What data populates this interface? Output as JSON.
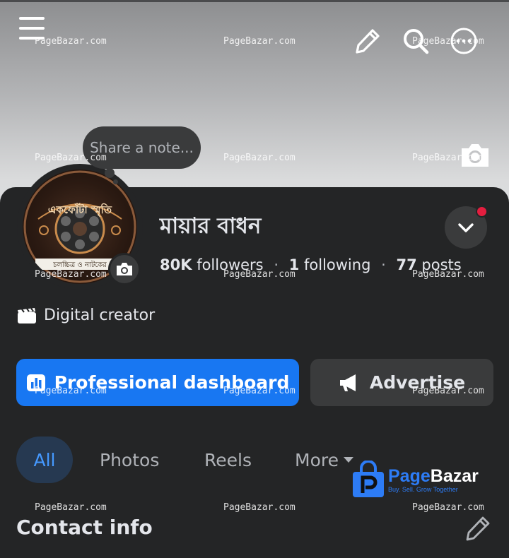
{
  "cover": {
    "menu_icon": "hamburger-icon",
    "edit_icon": "pencil-icon",
    "search_icon": "search-icon",
    "more_icon": "more-horizontal-icon",
    "camera_icon": "camera-icon"
  },
  "note": {
    "placeholder": "Share a note..."
  },
  "profile": {
    "name": "মায়ার বাধন",
    "followers": "80K",
    "followers_label": "followers",
    "following": "1",
    "following_label": "following",
    "posts": "77",
    "posts_label": "posts",
    "separator": "·",
    "category": "Digital creator",
    "avatar_text": "একফোঁটা স্মৃতি",
    "avatar_subtext": "চলচ্চিত্র ও নাটকের"
  },
  "buttons": {
    "dashboard": "Professional dashboard",
    "advertise": "Advertise"
  },
  "tabs": {
    "all": "All",
    "photos": "Photos",
    "reels": "Reels",
    "more": "More"
  },
  "contact": {
    "title": "Contact info"
  },
  "watermark": {
    "text": "PageBazar.com",
    "logo_name_part1": "Page",
    "logo_name_part2": "Bazar",
    "logo_tagline": "Buy. Sell. Grow Together"
  },
  "colors": {
    "primary": "#1877f2",
    "background": "#242526",
    "surface": "#3a3b3c",
    "notification": "#e41e3f",
    "active_tab": "#4599ff"
  }
}
